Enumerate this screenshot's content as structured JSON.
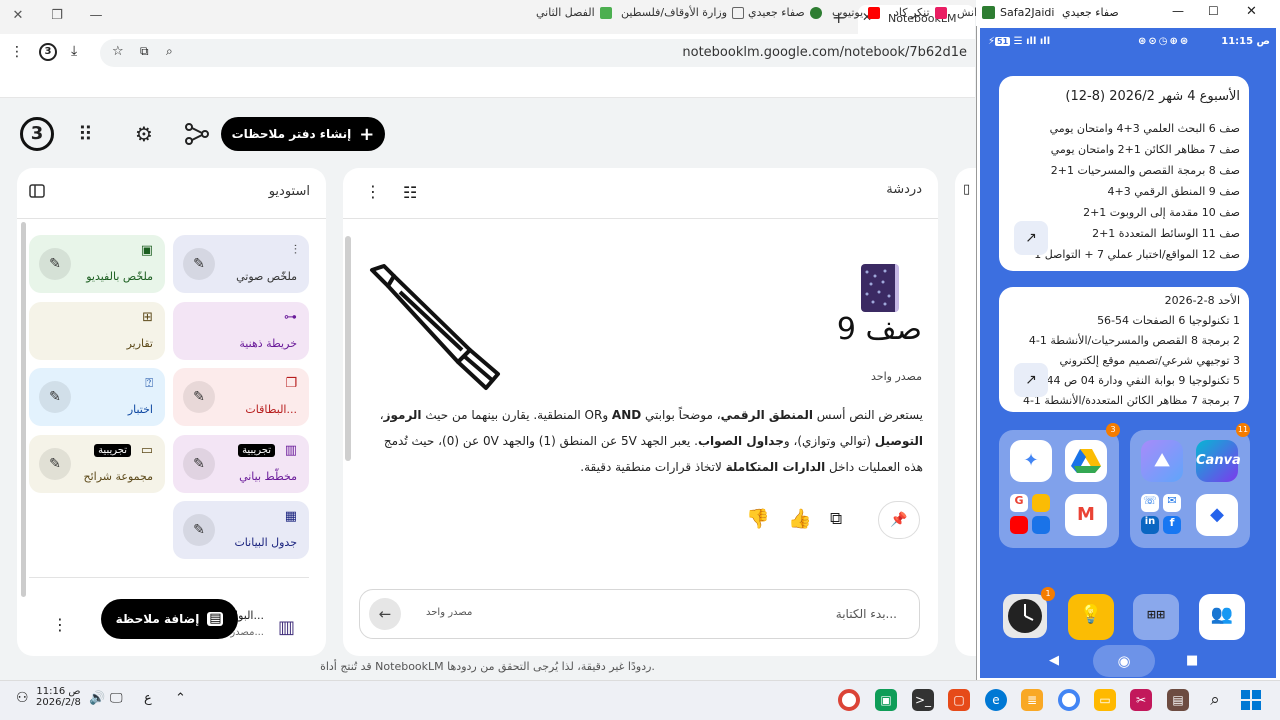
{
  "browser": {
    "tab_title": "NotebookLM",
    "url": "notebooklm.google.com/notebook/7b62d1e",
    "bookmarks": [
      {
        "label": "الفصل الثاني",
        "color": "#4caf50"
      },
      {
        "label": "وزارة الأوقاف/فلسطين",
        "color": "#666666"
      },
      {
        "label": "صفاء جعيدي",
        "color": "#2e7d32"
      },
      {
        "label": "يوتيوب",
        "color": "#ff0000"
      },
      {
        "label": "تنكر كاد",
        "color": "#e91e63"
      },
      {
        "label": "انش",
        "color": "#999999"
      }
    ]
  },
  "app": {
    "logo": "3",
    "new_notebook_label": "إنشاء دفتر ملاحظات",
    "studio": {
      "title": "استوديو",
      "tiles": [
        {
          "label": "ملخّص صوتي",
          "icon": "audio-wave-icon",
          "bg": "#e8eaf6",
          "color": "#333333"
        },
        {
          "label": "ملخّص بالفيديو",
          "icon": "video-icon",
          "bg": "#e8f5e9",
          "color": "#1b5e20"
        },
        {
          "label": "خريطة ذهنية",
          "icon": "mindmap-icon",
          "bg": "#f3e5f5",
          "color": "#6a1b9a"
        },
        {
          "label": "تقارير",
          "icon": "report-icon",
          "bg": "#f5f3e8",
          "color": "#5d4a1a"
        },
        {
          "label": "البطاقات...",
          "icon": "cards-icon",
          "bg": "#fcebeb",
          "color": "#b71c1c"
        },
        {
          "label": "اختبار",
          "icon": "quiz-icon",
          "bg": "#e3f2fd",
          "color": "#0d47a1"
        },
        {
          "label": "مخطّط بياني",
          "icon": "chart-icon",
          "bg": "#f3e5f5",
          "color": "#6a1b9a",
          "badge": "تجريبية"
        },
        {
          "label": "مجموعة شرائح",
          "icon": "slides-icon",
          "bg": "#f5f3e8",
          "color": "#5d4a1a",
          "badge": "تجريبية"
        },
        {
          "label": "جدول البيانات",
          "icon": "table-icon",
          "bg": "#e8eaf6",
          "color": "#1a237e"
        }
      ],
      "bottom_item_title": "البوابا...",
      "bottom_item_sub": "مصدر و...",
      "add_note_label": "إضافة ملاحظة"
    },
    "chat": {
      "title": "دردشة",
      "notebook_title": "صف 9",
      "source_count": "مصدر واحد",
      "summary_parts": [
        {
          "text": "يستعرض النص أسس ",
          "bold": false
        },
        {
          "text": "المنطق الرقمي",
          "bold": true
        },
        {
          "text": "، موضحاً بوابتي ",
          "bold": false
        },
        {
          "text": "AND",
          "bold": true
        },
        {
          "text": " و",
          "bold": false
        },
        {
          "text": "OR",
          "bold": false
        },
        {
          "text": " المنطقية. يقارن بينهما من حيث ",
          "bold": false
        },
        {
          "text": "الرموز",
          "bold": true
        },
        {
          "text": "، ",
          "bold": false
        },
        {
          "text": "التوصيل",
          "bold": true
        },
        {
          "text": " (توالي وتوازي)، و",
          "bold": false
        },
        {
          "text": "جداول الصواب",
          "bold": true
        },
        {
          "text": ". يعبر الجهد 5V عن المنطق (1) والجهد 0V عن (0)، حيث تُدمج هذه العمليات داخل ",
          "bold": false
        },
        {
          "text": "الدارات المتكاملة",
          "bold": true
        },
        {
          "text": " لاتخاذ قرارات منطقية دقيقة.",
          "bold": false
        }
      ],
      "input_placeholder": "بدء الكتابة...",
      "input_source": "مصدر واحد"
    },
    "footer": "قد تُنتج أداة NotebookLM ردودًا غير دقيقة، لذا يُرجى التحقق من ردودها."
  },
  "phone": {
    "window_title": "Safa2Jaidi",
    "window_title_ar": "صفاء جعيدي",
    "status_time": "11:15 ص",
    "battery": "51",
    "widget1": {
      "title": "الأسبوع 4 شهر 2026/2 (8-12)",
      "lines": [
        "صف 6 البحث العلمي 3+4 وامتحان يومي",
        "صف 7 مظاهر الكائن 1+2 وامتحان يومي",
        "صف 8 برمجة القصص والمسرحيات 1+2",
        "صف 9 المنطق الرقمي 3+4",
        "صف 10 مقدمة إلى الروبوت 1+2",
        "صف 11 الوسائط المتعددة 1+2",
        "صف 12 المواقع/اختبار عملي 7 + التواصل 1"
      ]
    },
    "widget2": {
      "lines": [
        "الأحد 8-2-2026",
        "1 تكنولوجيا 6 الصفحات 54-56",
        "2 برمجة 8 القصص والمسرحيات/الأنشطة 1-4",
        "3 توجيهي شرعي/تصميم موقع إلكتروني",
        "5 تكنولوجيا 9 بوابة النفي ودارة 04 ص 44",
        "7 برمجة 7 مظاهر الكائن المتعددة/الأنشطة 1-4"
      ]
    },
    "folder1_badge": "3",
    "folder2_badge": "11",
    "dock_badge": "1"
  },
  "taskbar": {
    "time": "11:16 ص",
    "date": "2026/2/8",
    "lang": "ع"
  }
}
